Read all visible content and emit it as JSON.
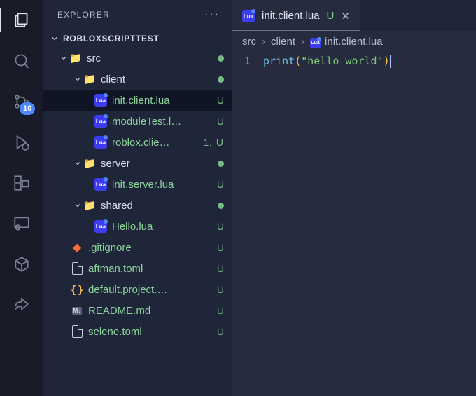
{
  "activity": {
    "scm_badge": "10"
  },
  "sidebar": {
    "title": "EXPLORER",
    "section": "ROBLOXSCRIPTTEST"
  },
  "tree": {
    "src": {
      "label": "src",
      "status": "dot"
    },
    "client": {
      "label": "client",
      "status": "dot"
    },
    "init_cl": {
      "label": "init.client.lua",
      "status": "U"
    },
    "modtest": {
      "label": "moduleTest.l…",
      "status": "U"
    },
    "robloxcl": {
      "label": "roblox.clie…",
      "status": "1, U"
    },
    "server": {
      "label": "server",
      "status": "dot"
    },
    "init_sv": {
      "label": "init.server.lua",
      "status": "U"
    },
    "shared": {
      "label": "shared",
      "status": "dot"
    },
    "hello": {
      "label": "Hello.lua",
      "status": "U"
    },
    "gitignore": {
      "label": ".gitignore",
      "status": "U"
    },
    "aftman": {
      "label": "aftman.toml",
      "status": "U"
    },
    "defproj": {
      "label": "default.project.…",
      "status": "U"
    },
    "readme": {
      "label": "README.md",
      "status": "U"
    },
    "selene": {
      "label": "selene.toml",
      "status": "U"
    }
  },
  "tab": {
    "label": "init.client.lua",
    "git": "U"
  },
  "breadcrumb": {
    "a": "src",
    "b": "client",
    "c": "init.client.lua"
  },
  "code": {
    "lineno": "1",
    "fn": "print",
    "open": "(",
    "str": "\"hello world\"",
    "close": ")"
  }
}
